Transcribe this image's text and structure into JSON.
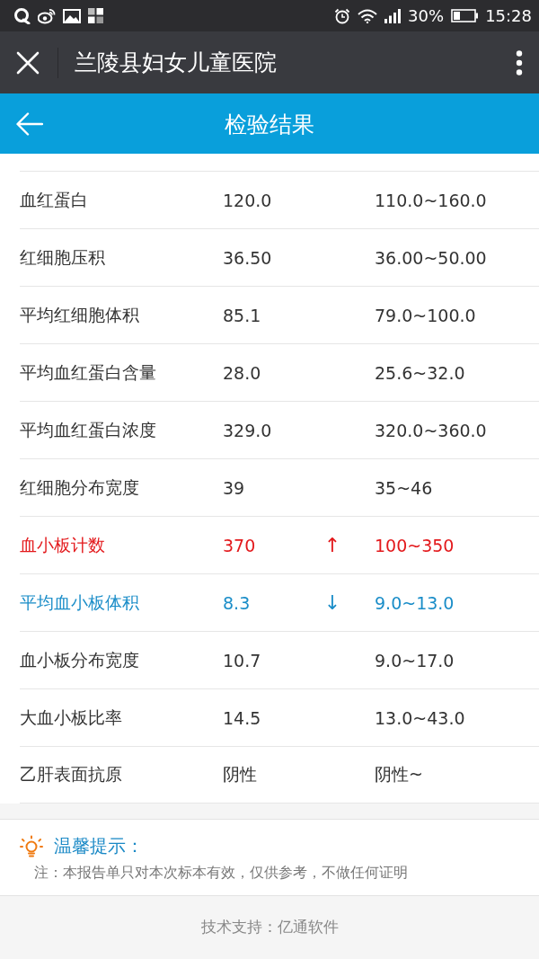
{
  "status_bar": {
    "battery_percent": "30%",
    "time": "15:28"
  },
  "top_bar": {
    "title": "兰陵县妇女儿童医院"
  },
  "header": {
    "title": "检验结果"
  },
  "results": [
    {
      "name": "血红蛋白",
      "value": "120.0",
      "range": "110.0~160.0",
      "above_range": false,
      "below_range": false
    },
    {
      "name": "红细胞压积",
      "value": "36.50",
      "range": "36.00~50.00",
      "above_range": false,
      "below_range": false
    },
    {
      "name": "平均红细胞体积",
      "value": "85.1",
      "range": "79.0~100.0",
      "above_range": false,
      "below_range": false
    },
    {
      "name": "平均血红蛋白含量",
      "value": "28.0",
      "range": "25.6~32.0",
      "above_range": false,
      "below_range": false
    },
    {
      "name": "平均血红蛋白浓度",
      "value": "329.0",
      "range": "320.0~360.0",
      "above_range": false,
      "below_range": false
    },
    {
      "name": "红细胞分布宽度",
      "value": "39",
      "range": "35~46",
      "above_range": false,
      "below_range": false
    },
    {
      "name": "血小板计数",
      "value": "370",
      "arrow": "↑",
      "range": "100~350",
      "above_range": true,
      "below_range": false
    },
    {
      "name": "平均血小板体积",
      "value": "8.3",
      "arrow": "↓",
      "range": "9.0~13.0",
      "above_range": false,
      "below_range": true
    },
    {
      "name": "血小板分布宽度",
      "value": "10.7",
      "range": "9.0~17.0",
      "above_range": false,
      "below_range": false
    },
    {
      "name": "大血小板比率",
      "value": "14.5",
      "range": "13.0~43.0",
      "above_range": false,
      "below_range": false
    },
    {
      "name": "乙肝表面抗原",
      "value": "阴性",
      "range": "阴性~",
      "above_range": false,
      "below_range": false
    }
  ],
  "tips": {
    "title": "温馨提示：",
    "note": "注：本报告单只对本次标本有效，仅供参考，不做任何证明"
  },
  "footer": {
    "text": "技术支持：亿通软件"
  }
}
